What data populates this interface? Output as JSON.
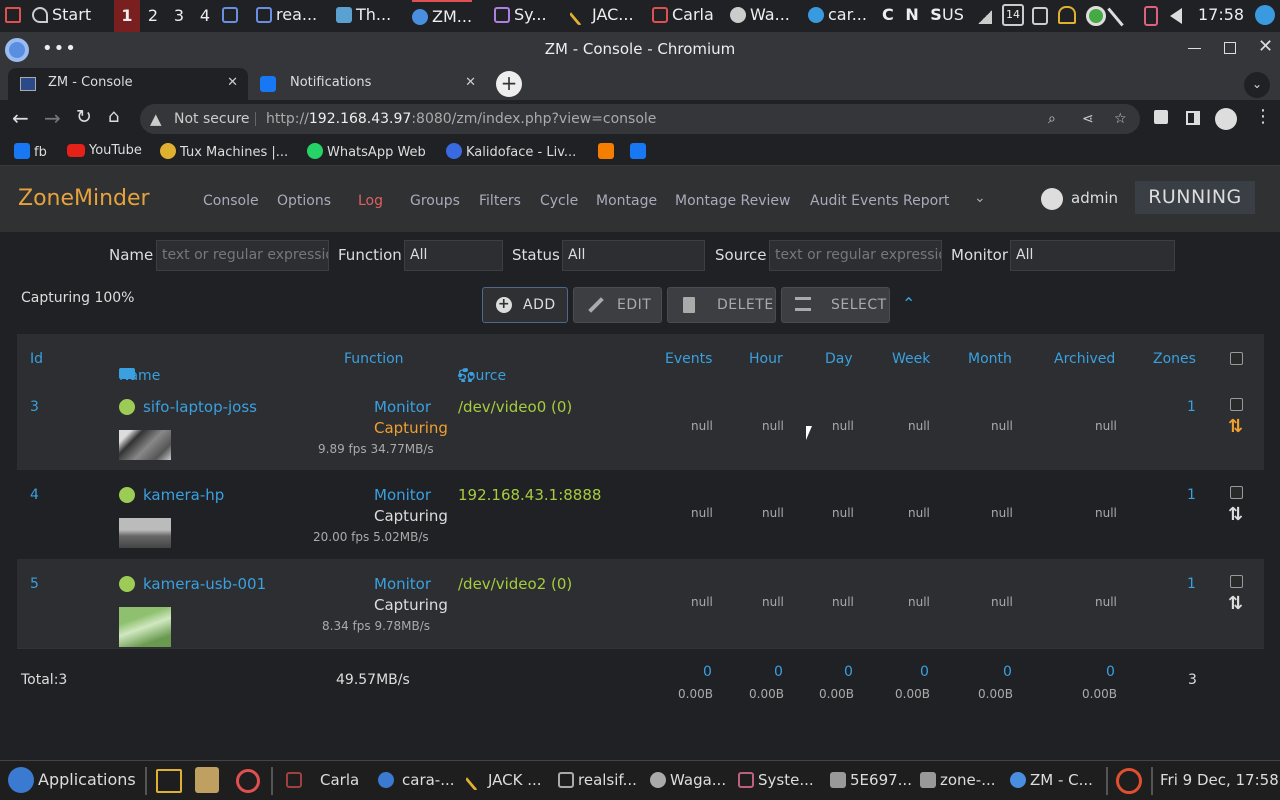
{
  "ospanel": {
    "start": "Start",
    "workspaces": [
      "1",
      "2",
      "3",
      "4"
    ],
    "tasks": [
      "rea...",
      "Th...",
      "ZM...",
      "Sy...",
      "JAC...",
      "Carla",
      "Wa...",
      "car..."
    ],
    "keyboard": "C N S",
    "layout": "US",
    "calendar_day": "14",
    "clock": "17:58"
  },
  "window": {
    "title": "ZM - Console - Chromium"
  },
  "tabs": [
    {
      "label": "ZM - Console"
    },
    {
      "label": "Notifications"
    }
  ],
  "omnibox": {
    "security": "Not secure",
    "url_prefix": "http://",
    "url_host": "192.168.43.97",
    "url_rest": ":8080/zm/index.php?view=console"
  },
  "bookmarks": [
    "fb",
    "YouTube",
    "Tux Machines |...",
    "WhatsApp Web",
    "Kalidoface - Liv..."
  ],
  "zm": {
    "brand": "ZoneMinder",
    "nav": [
      "Console",
      "Options",
      "Log",
      "Groups",
      "Filters",
      "Cycle",
      "Montage",
      "Montage Review",
      "Audit Events Report"
    ],
    "user": "admin",
    "state": "RUNNING",
    "filters": {
      "name_label": "Name",
      "name_placeholder": "text or regular expression",
      "function_label": "Function",
      "function_value": "All",
      "status_label": "Status",
      "status_value": "All",
      "source_label": "Source",
      "source_placeholder": "text or regular expression",
      "monitor_label": "Monitor",
      "monitor_value": "All"
    },
    "capturing": "Capturing 100%",
    "buttons": {
      "add": "ADD",
      "edit": "EDIT",
      "delete": "DELETE",
      "select": "SELECT"
    },
    "columns": [
      "Id",
      "Name",
      "Function",
      "Source",
      "Events",
      "Hour",
      "Day",
      "Week",
      "Month",
      "Archived",
      "Zones"
    ],
    "rows": [
      {
        "id": "3",
        "name": "sifo-laptop-joss",
        "function": "Monitor",
        "status": "Capturing",
        "status_color": "#f0a030",
        "stats": "9.89 fps 34.77MB/s",
        "source": "/dev/video0 (0)",
        "events": "null",
        "hour": "null",
        "day": "null",
        "week": "null",
        "month": "null",
        "archived": "null",
        "zones": "1",
        "sort_color": "#f0a030"
      },
      {
        "id": "4",
        "name": "kamera-hp",
        "function": "Monitor",
        "status": "Capturing",
        "status_color": "#dddddd",
        "stats": "20.00 fps 5.02MB/s",
        "source": "192.168.43.1:8888",
        "events": "null",
        "hour": "null",
        "day": "null",
        "week": "null",
        "month": "null",
        "archived": "null",
        "zones": "1",
        "sort_color": "#dddddd"
      },
      {
        "id": "5",
        "name": "kamera-usb-001",
        "function": "Monitor",
        "status": "Capturing",
        "status_color": "#dddddd",
        "stats": "8.34 fps 9.78MB/s",
        "source": "/dev/video2 (0)",
        "events": "null",
        "hour": "null",
        "day": "null",
        "week": "null",
        "month": "null",
        "archived": "null",
        "zones": "1",
        "sort_color": "#dddddd"
      }
    ],
    "totals": {
      "label": "Total:3",
      "bandwidth": "49.57MB/s",
      "events": "0",
      "events_size": "0.00B",
      "hour": "0",
      "hour_size": "0.00B",
      "day": "0",
      "day_size": "0.00B",
      "week": "0",
      "week_size": "0.00B",
      "month": "0",
      "month_size": "0.00B",
      "archived": "0",
      "archived_size": "0.00B",
      "zones": "3"
    }
  },
  "taskbar": {
    "applications": "Applications",
    "tasks": [
      "Carla",
      "cara-...",
      "JACK ...",
      "realsif...",
      "Waga...",
      "Syste...",
      "5E697...",
      "zone-...",
      "ZM - C..."
    ],
    "clock": "Fri  9 Dec, 17:58"
  },
  "colors": {
    "accent": "#3aa0e0",
    "brand": "#e6a23c",
    "log": "#e06060",
    "source": "#a6cc3c"
  }
}
